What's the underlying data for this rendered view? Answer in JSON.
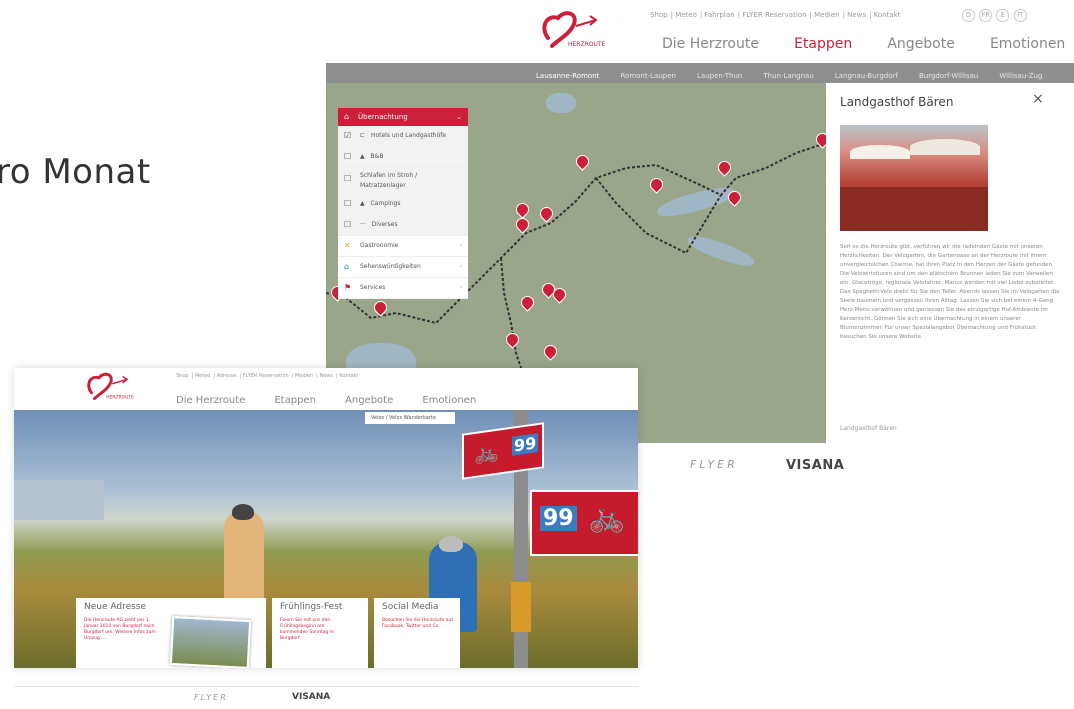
{
  "slide": {
    "partial_title": "ro Monat"
  },
  "back_page": {
    "logo_text": "HERZROUTE",
    "top_links": [
      "Shop",
      "Meteo",
      "Fahrplan",
      "FLYER Reservation",
      "Medien",
      "News",
      "Kontakt"
    ],
    "lang_buttons": [
      "D",
      "FR",
      "E",
      "IT"
    ],
    "main_nav": [
      {
        "label": "Die Herzroute",
        "active": false
      },
      {
        "label": "Etappen",
        "active": true
      },
      {
        "label": "Angebote",
        "active": false
      },
      {
        "label": "Emotionen",
        "active": false
      }
    ],
    "stage_nav": [
      "Lausanne-Romont",
      "Romont-Laupen",
      "Laupen-Thun",
      "Thun-Langnau",
      "Langnau-Burgdorf",
      "Burgdorf-Willisau",
      "Willisau-Zug"
    ],
    "filter_panel": {
      "header": "Übernachtung",
      "sub_items": [
        {
          "icon": "bed-icon",
          "label": "Hotels und Landgasthöfe",
          "checked": true
        },
        {
          "icon": "house-icon",
          "label": "B&B",
          "checked": false
        },
        {
          "icon": "hay-icon",
          "label": "Schlafen im Stroh / Matratzenlager",
          "checked": false
        },
        {
          "icon": "tent-icon",
          "label": "Campings",
          "checked": false
        },
        {
          "icon": "dots-icon",
          "label": "Diverses",
          "checked": false
        }
      ],
      "categories": [
        {
          "icon": "fork-icon",
          "label": "Gastronomie"
        },
        {
          "icon": "museum-icon",
          "label": "Sehenswürdigkeiten"
        },
        {
          "icon": "flag-icon",
          "label": "Services"
        }
      ]
    },
    "info_panel": {
      "title": "Landgasthof Bären",
      "close": "×",
      "description": "Seit es die Herzroute gibt, verführen wir die radelnden Gäste mit unseren Herzlichkeiten. Der Velogarten, die Gartenoase an der Herzroute mit ihrem unvergleichlichen Charme, hat ihren Platz in den Herzen der Gäste gefunden. Die Velowirtsituren sind um den plätschern Brunnen laden Sie zum Verweilen ein. Glacetröge, regionale Velofahrer, Manus werden mit viel Liebe zubereitet. Das Spaghetti-Velo dreht für Sie den Teller. Abends lassen Sie im Velogarten die Seele baumeln und vergessen Ihren Alltag. Lassen Sie sich bei einem 4-Gang Herz-Menu verwöhnen und geniessen Sie das einzigartige Hof-Ambiente im Kerzenlicht. Gönnen Sie sich eine Übernachtung in einem unserer Blumenzimmer. Für unser Spezialangebot Übernachtung und Frühstück besuchen Sie unsere Website.",
      "address": "Landgasthof Bären"
    },
    "sponsors": [
      "FLYER",
      "VISANA"
    ]
  },
  "front_page": {
    "logo_text": "HERZROUTE",
    "top_links": [
      "Shop",
      "Meteo",
      "Adresse",
      "FLYER Reservation",
      "Medien",
      "News",
      "Kontakt"
    ],
    "main_nav": [
      {
        "label": "Die Herzroute"
      },
      {
        "label": "Etappen"
      },
      {
        "label": "Angebote"
      },
      {
        "label": "Emotionen"
      }
    ],
    "cta_button": "Velos / Velos Wanderkarte",
    "sign_numbers": [
      "99",
      "99"
    ],
    "cards": [
      {
        "title": "Neue Adresse",
        "text": "Die Herzroute AG zieht per 1. Januar 2014 von Burgdorf nach Burgdorf um. Weitere Infos zum Umzug ..."
      },
      {
        "title": "Frühlings-Fest",
        "text": "Feiern Sie mit uns den Frühlingsbeginn am kommenden Sonntag in Burgdorf."
      },
      {
        "title": "Social Media",
        "text": "Besuchen Sie die Herzroute auf Facebook, Twitter und Co."
      }
    ],
    "sponsors": [
      "FLYER",
      "VISANA"
    ]
  }
}
